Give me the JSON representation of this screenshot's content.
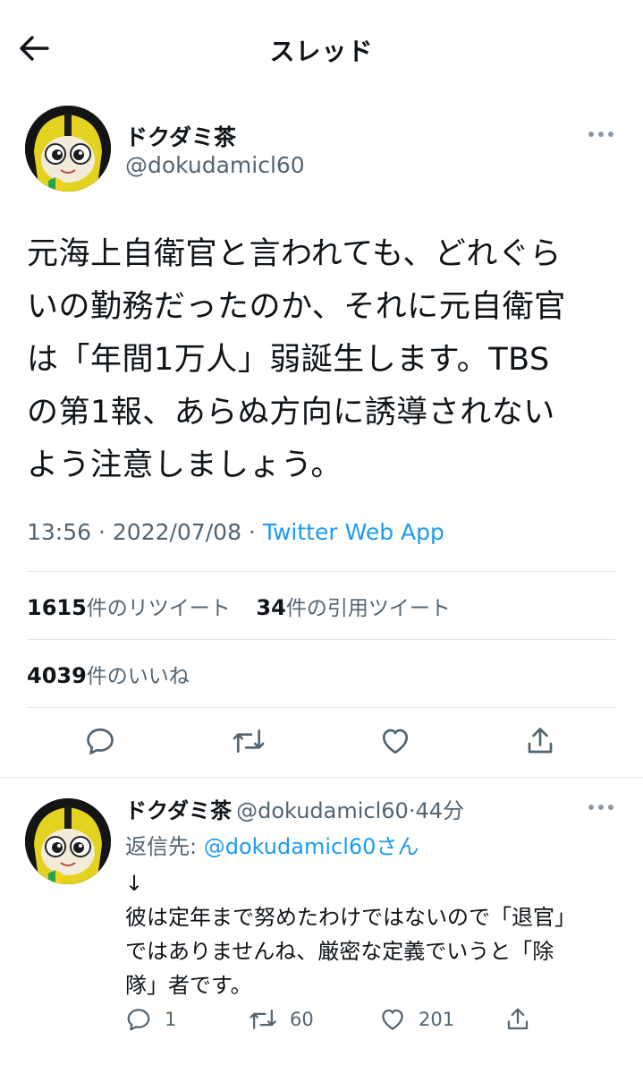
{
  "header": {
    "title": "スレッド",
    "back_icon": "arrow-left-icon"
  },
  "tweet": {
    "author_name": "ドクダミ茶",
    "author_handle": "@dokudamicl60",
    "text": "元海上自衛官と言われても、どれぐら\nいの勤務だったのか、それに元自衛官\nは「年間1万人」弱誕生します。TBS\nの第1報、あらぬ方向に誘導されない\nよう注意しましょう。",
    "time": "13:56",
    "date": "2022/07/08",
    "separator": " · ",
    "app": "Twitter Web App",
    "retweets_count": "1615",
    "retweets_label": "件のリツイート",
    "quotes_count": "34",
    "quotes_label": "件の引用ツイート",
    "likes_count": "4039",
    "likes_label": "件のいいね"
  },
  "reply": {
    "author_name": "ドクダミ茶",
    "author_handle": "@dokudamicl60",
    "time_sep": "·",
    "time": "44分",
    "reply_to_prefix": "返信先: ",
    "reply_to_handle": "@dokudamicl60",
    "reply_to_suffix": "さん",
    "text": "↓\n彼は定年まで努めたわけではないので「退官」\nではありませんね、厳密な定義でいうと「除\n隊」者です。",
    "reply_count": "1",
    "retweet_count": "60",
    "like_count": "201"
  },
  "colors": {
    "accent": "#1d9bf0",
    "secondary_text": "#536471",
    "divider": "#e1e8ed"
  }
}
